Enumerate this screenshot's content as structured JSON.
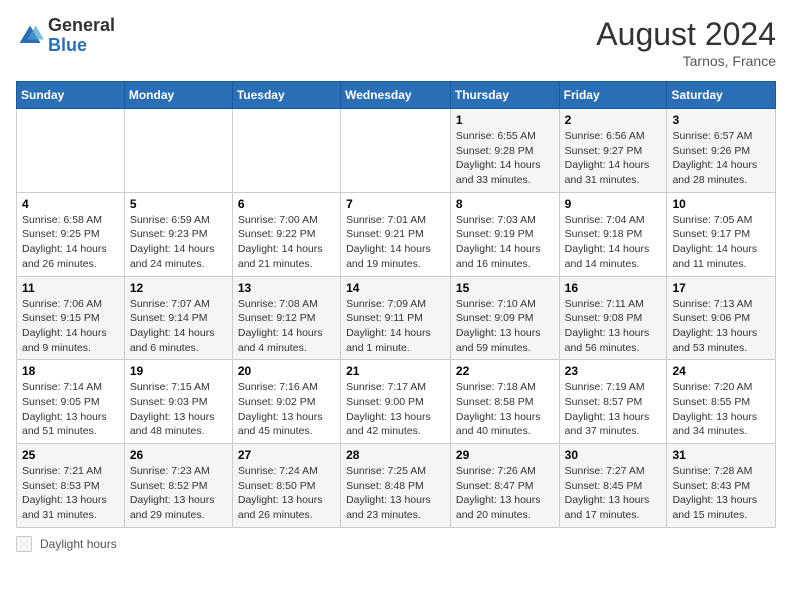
{
  "header": {
    "logo_general": "General",
    "logo_blue": "Blue",
    "month_year": "August 2024",
    "location": "Tarnos, France"
  },
  "days_of_week": [
    "Sunday",
    "Monday",
    "Tuesday",
    "Wednesday",
    "Thursday",
    "Friday",
    "Saturday"
  ],
  "weeks": [
    [
      {
        "day": "",
        "info": ""
      },
      {
        "day": "",
        "info": ""
      },
      {
        "day": "",
        "info": ""
      },
      {
        "day": "",
        "info": ""
      },
      {
        "day": "1",
        "info": "Sunrise: 6:55 AM\nSunset: 9:28 PM\nDaylight: 14 hours and 33 minutes."
      },
      {
        "day": "2",
        "info": "Sunrise: 6:56 AM\nSunset: 9:27 PM\nDaylight: 14 hours and 31 minutes."
      },
      {
        "day": "3",
        "info": "Sunrise: 6:57 AM\nSunset: 9:26 PM\nDaylight: 14 hours and 28 minutes."
      }
    ],
    [
      {
        "day": "4",
        "info": "Sunrise: 6:58 AM\nSunset: 9:25 PM\nDaylight: 14 hours and 26 minutes."
      },
      {
        "day": "5",
        "info": "Sunrise: 6:59 AM\nSunset: 9:23 PM\nDaylight: 14 hours and 24 minutes."
      },
      {
        "day": "6",
        "info": "Sunrise: 7:00 AM\nSunset: 9:22 PM\nDaylight: 14 hours and 21 minutes."
      },
      {
        "day": "7",
        "info": "Sunrise: 7:01 AM\nSunset: 9:21 PM\nDaylight: 14 hours and 19 minutes."
      },
      {
        "day": "8",
        "info": "Sunrise: 7:03 AM\nSunset: 9:19 PM\nDaylight: 14 hours and 16 minutes."
      },
      {
        "day": "9",
        "info": "Sunrise: 7:04 AM\nSunset: 9:18 PM\nDaylight: 14 hours and 14 minutes."
      },
      {
        "day": "10",
        "info": "Sunrise: 7:05 AM\nSunset: 9:17 PM\nDaylight: 14 hours and 11 minutes."
      }
    ],
    [
      {
        "day": "11",
        "info": "Sunrise: 7:06 AM\nSunset: 9:15 PM\nDaylight: 14 hours and 9 minutes."
      },
      {
        "day": "12",
        "info": "Sunrise: 7:07 AM\nSunset: 9:14 PM\nDaylight: 14 hours and 6 minutes."
      },
      {
        "day": "13",
        "info": "Sunrise: 7:08 AM\nSunset: 9:12 PM\nDaylight: 14 hours and 4 minutes."
      },
      {
        "day": "14",
        "info": "Sunrise: 7:09 AM\nSunset: 9:11 PM\nDaylight: 14 hours and 1 minute."
      },
      {
        "day": "15",
        "info": "Sunrise: 7:10 AM\nSunset: 9:09 PM\nDaylight: 13 hours and 59 minutes."
      },
      {
        "day": "16",
        "info": "Sunrise: 7:11 AM\nSunset: 9:08 PM\nDaylight: 13 hours and 56 minutes."
      },
      {
        "day": "17",
        "info": "Sunrise: 7:13 AM\nSunset: 9:06 PM\nDaylight: 13 hours and 53 minutes."
      }
    ],
    [
      {
        "day": "18",
        "info": "Sunrise: 7:14 AM\nSunset: 9:05 PM\nDaylight: 13 hours and 51 minutes."
      },
      {
        "day": "19",
        "info": "Sunrise: 7:15 AM\nSunset: 9:03 PM\nDaylight: 13 hours and 48 minutes."
      },
      {
        "day": "20",
        "info": "Sunrise: 7:16 AM\nSunset: 9:02 PM\nDaylight: 13 hours and 45 minutes."
      },
      {
        "day": "21",
        "info": "Sunrise: 7:17 AM\nSunset: 9:00 PM\nDaylight: 13 hours and 42 minutes."
      },
      {
        "day": "22",
        "info": "Sunrise: 7:18 AM\nSunset: 8:58 PM\nDaylight: 13 hours and 40 minutes."
      },
      {
        "day": "23",
        "info": "Sunrise: 7:19 AM\nSunset: 8:57 PM\nDaylight: 13 hours and 37 minutes."
      },
      {
        "day": "24",
        "info": "Sunrise: 7:20 AM\nSunset: 8:55 PM\nDaylight: 13 hours and 34 minutes."
      }
    ],
    [
      {
        "day": "25",
        "info": "Sunrise: 7:21 AM\nSunset: 8:53 PM\nDaylight: 13 hours and 31 minutes."
      },
      {
        "day": "26",
        "info": "Sunrise: 7:23 AM\nSunset: 8:52 PM\nDaylight: 13 hours and 29 minutes."
      },
      {
        "day": "27",
        "info": "Sunrise: 7:24 AM\nSunset: 8:50 PM\nDaylight: 13 hours and 26 minutes."
      },
      {
        "day": "28",
        "info": "Sunrise: 7:25 AM\nSunset: 8:48 PM\nDaylight: 13 hours and 23 minutes."
      },
      {
        "day": "29",
        "info": "Sunrise: 7:26 AM\nSunset: 8:47 PM\nDaylight: 13 hours and 20 minutes."
      },
      {
        "day": "30",
        "info": "Sunrise: 7:27 AM\nSunset: 8:45 PM\nDaylight: 13 hours and 17 minutes."
      },
      {
        "day": "31",
        "info": "Sunrise: 7:28 AM\nSunset: 8:43 PM\nDaylight: 13 hours and 15 minutes."
      }
    ]
  ],
  "legend": {
    "label": "Daylight hours"
  }
}
